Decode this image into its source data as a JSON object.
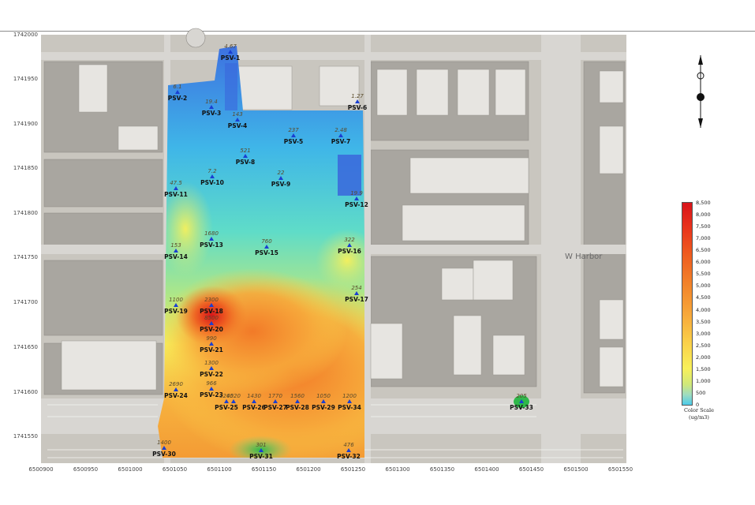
{
  "map": {
    "y_ticks": [
      "1742000",
      "1741950",
      "1741900",
      "1741850",
      "1741800",
      "1741750",
      "1741700",
      "1741650",
      "1741600",
      "1741550"
    ],
    "x_ticks": [
      "6500900",
      "6500950",
      "6501000",
      "6501050",
      "6501100",
      "6501150",
      "6501200",
      "6501250",
      "6501300",
      "6501350",
      "6501400",
      "6501450",
      "6501500",
      "6501550"
    ],
    "street_label": "W Harbor",
    "colors": {
      "high": "#d8131a",
      "mid": "#f2822a",
      "low_mid": "#fad24a",
      "low": "#9fdcc0",
      "lowest": "#4ccbea",
      "marker": "#1a3fd1"
    }
  },
  "probes": [
    {
      "id": "PSV-1",
      "value": "4.67"
    },
    {
      "id": "PSV-2",
      "value": "6.1"
    },
    {
      "id": "PSV-3",
      "value": "19.4"
    },
    {
      "id": "PSV-4",
      "value": "143"
    },
    {
      "id": "PSV-5",
      "value": "237"
    },
    {
      "id": "PSV-6",
      "value": "1.27"
    },
    {
      "id": "PSV-7",
      "value": "2.48"
    },
    {
      "id": "PSV-8",
      "value": "521"
    },
    {
      "id": "PSV-9",
      "value": "22"
    },
    {
      "id": "PSV-10",
      "value": "7.2"
    },
    {
      "id": "PSV-11",
      "value": "47.5"
    },
    {
      "id": "PSV-12",
      "value": "19.9"
    },
    {
      "id": "PSV-13",
      "value": "1680"
    },
    {
      "id": "PSV-14",
      "value": "153"
    },
    {
      "id": "PSV-15",
      "value": "760"
    },
    {
      "id": "PSV-16",
      "value": "322"
    },
    {
      "id": "PSV-17",
      "value": "254"
    },
    {
      "id": "PSV-18",
      "value": "2300"
    },
    {
      "id": "PSV-19",
      "value": "1100"
    },
    {
      "id": "PSV-20",
      "value": "8500"
    },
    {
      "id": "PSV-21",
      "value": "990"
    },
    {
      "id": "PSV-22",
      "value": "1300"
    },
    {
      "id": "PSV-23",
      "value": "966"
    },
    {
      "id": "PSV-24",
      "value": "2690"
    },
    {
      "id": "PSV-25",
      "value": "1260"
    },
    {
      "id": "PSV-25b",
      "value": "4520"
    },
    {
      "id": "PSV-26",
      "value": "1430"
    },
    {
      "id": "PSV-27",
      "value": "1770"
    },
    {
      "id": "PSV-28",
      "value": "1560"
    },
    {
      "id": "PSV-29",
      "value": "1050"
    },
    {
      "id": "PSV-30",
      "value": "1400"
    },
    {
      "id": "PSV-31",
      "value": "301"
    },
    {
      "id": "PSV-32",
      "value": "476"
    },
    {
      "id": "PSV-33",
      "value": "205"
    },
    {
      "id": "PSV-34",
      "value": "1200"
    }
  ],
  "legend": {
    "ticks": [
      "8,500",
      "8,000",
      "7,500",
      "7,000",
      "6,500",
      "6,000",
      "5,500",
      "5,000",
      "4,500",
      "4,000",
      "3,500",
      "3,000",
      "2,500",
      "2,000",
      "1,500",
      "1,000",
      "500",
      "0"
    ],
    "title": "Color Scale",
    "units": "(ug/m3)"
  }
}
